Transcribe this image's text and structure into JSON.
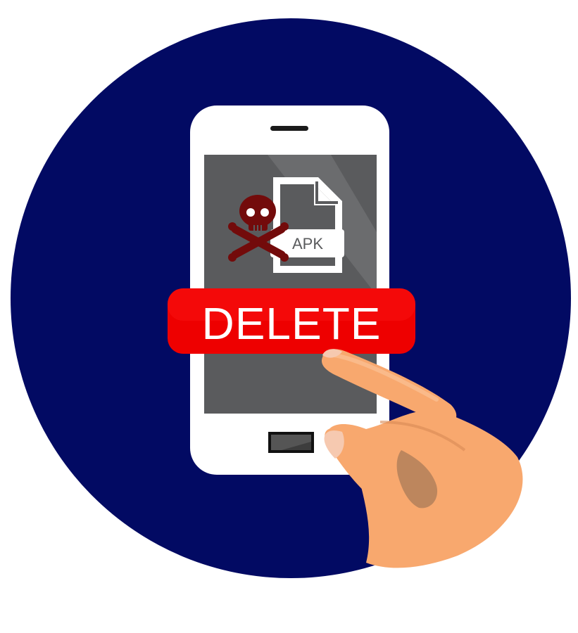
{
  "illustration": {
    "file_label": "APK",
    "action_button_label": "DELETE"
  },
  "colors": {
    "background": "#ffffff",
    "circle": "#020a63",
    "phone_body": "#ffffff",
    "screen": "#5a5b5d",
    "screen_light": "#6b6c6e",
    "button_red": "#ee0000",
    "skull": "#730b0b",
    "skin": "#f8a86e",
    "skin_shadow": "#d88a55",
    "home_button": "#2b2b2b"
  },
  "icons": {
    "skull": "skull-crossbones-icon",
    "file": "apk-file-icon",
    "hand": "pointing-hand"
  }
}
